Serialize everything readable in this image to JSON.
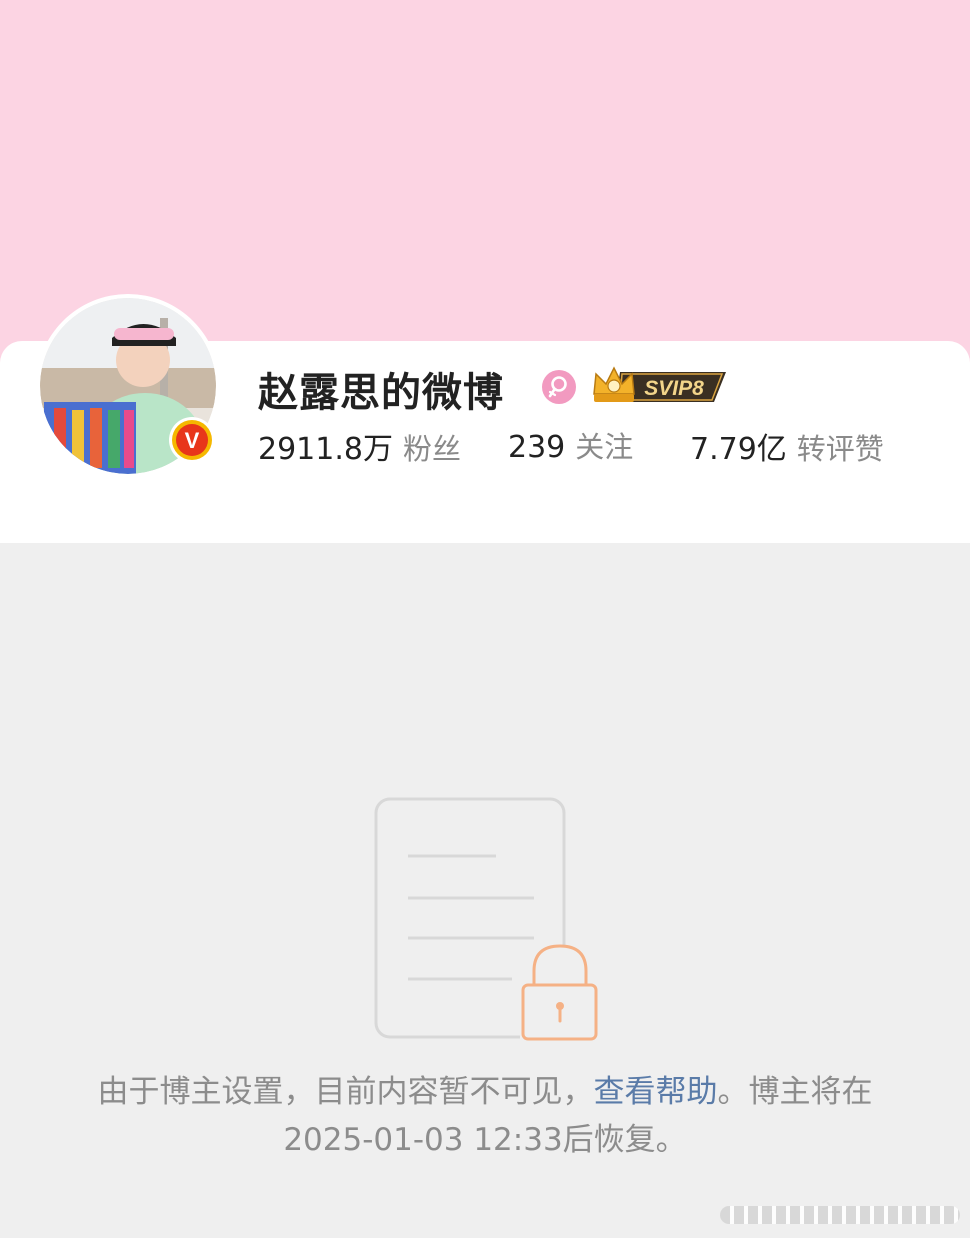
{
  "profile": {
    "name": "赵露思的微博",
    "vip_label": "SVIP8",
    "verified_mark": "V",
    "stats": [
      {
        "value": "2911.8万",
        "label": "粉丝"
      },
      {
        "value": "239",
        "label": "关注"
      },
      {
        "value": "7.79亿",
        "label": "转评赞"
      }
    ]
  },
  "notice": {
    "text_before": "由于博主设置，目前内容暂不可见，",
    "help_link": "查看帮助",
    "text_after": "。博主将在2025-01-03 12:33后恢复。"
  },
  "colors": {
    "cover": "#fcd4e3",
    "background": "#efefef",
    "link": "#5a7ba8",
    "lock": "#f5b185",
    "gender_badge": "#f29ac0"
  },
  "icons": {
    "gender": "female-icon",
    "verified": "verified-v-icon",
    "vip": "crown-icon",
    "locked": "locked-document-icon"
  }
}
